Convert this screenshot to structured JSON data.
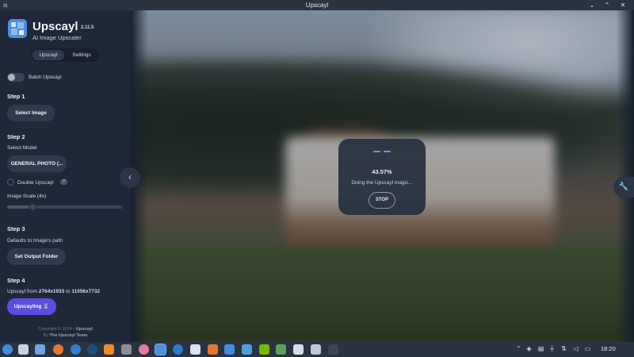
{
  "window": {
    "title": "Upscayl",
    "minimize_glyph": "⌄",
    "maximize_glyph": "⌃",
    "close_glyph": "✕"
  },
  "sidebar": {
    "brand": "Upscayl",
    "version": "2.11.5",
    "subtitle": "AI Image Upscaler",
    "tabs": [
      {
        "label": "Upscayl",
        "active": true
      },
      {
        "label": "Settings",
        "active": false
      }
    ],
    "batch_label": "Batch Upscayl",
    "batch_enabled": false,
    "step1": {
      "title": "Step 1",
      "button": "Select Image"
    },
    "step2": {
      "title": "Step 2",
      "model_label": "Select Model",
      "model_value": "GENERAL PHOTO (...",
      "double_label": "Double Upscayl",
      "double_help": "?",
      "scale_label": "Image Scale (4x)",
      "scale_fraction": 0.22
    },
    "step3": {
      "title": "Step 3",
      "desc": "Defaults to Image's path",
      "button": "Set Output Folder"
    },
    "step4": {
      "title": "Step 4",
      "from_prefix": "Upscayl from ",
      "from_size": "2764x1933",
      "to_word": " to ",
      "to_size": "11056x7732",
      "button": "Upscayling ⌛"
    },
    "footer": {
      "copyright": "Copyright © 2024 - ",
      "brand": "Upscayl",
      "by": "By ",
      "team": "The Upscayl Team"
    }
  },
  "main": {
    "progress": {
      "percent": "43.57%",
      "message": "Doing the Upscayl magic...",
      "stop": "STOP"
    }
  },
  "taskbar": {
    "clock": "18:20"
  },
  "colors": {
    "accent": "#5b4ddf",
    "sidebar": "#1f2838",
    "progress_blue": "#6a9be6"
  }
}
